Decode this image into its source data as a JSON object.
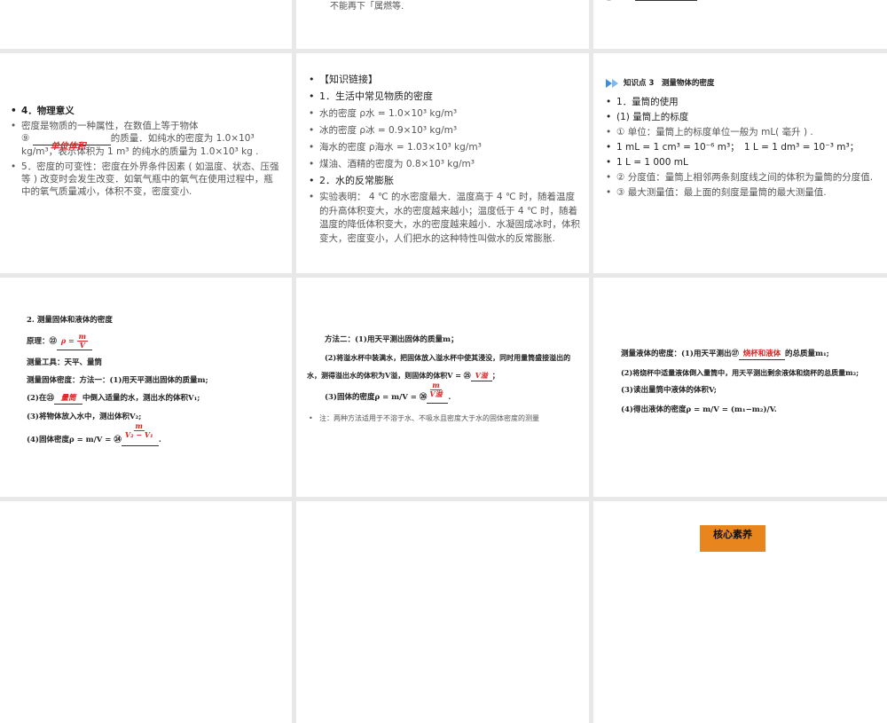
{
  "row1": {
    "mid_text": "不能再下「属燃等.",
    "right_label": "⑤"
  },
  "s4": {
    "items": [
      "4．物理意义",
      "密度是物质的一种属性，在数值上等于物体",
      "的质量．如纯水的密度为 1.0×10³",
      "kg/m³，表示体积为 1 m³ 的纯水的质量为 1.0×10³ kg .",
      "5．密度的可变性：密度在外界条件因素 ( 如温度、状态、压强等 ) 改变时会发生改变．如氧气瓶中的氧气在使用过程中，瓶中的氧气质量减小，体积不变，密度变小."
    ],
    "num": "⑨",
    "answer": "单位体积"
  },
  "s5": {
    "items": [
      "【知识链接】",
      "1．生活中常见物质的密度",
      "水的密度 ρ水 = 1.0×10³ kg/m³",
      "冰的密度 ρ冰 = 0.9×10³ kg/m³",
      "海水的密度 ρ海水 = 1.03×10³ kg/m³",
      "煤油、酒精的密度为 0.8×10³ kg/m³",
      "2．水的反常膨胀",
      "实验表明： 4 ℃ 的水密度最大．温度高于 4 ℃ 时，随着温度的升高体积变大，水的密度越来越小；温度低于 4 ℃ 时，随着温度的降低体积变大，水的密度越来越小．水凝固成冰时，体积变大，密度变小，人们把水的这种特性叫做水的反常膨胀."
    ]
  },
  "s6": {
    "header": "知识点 3　测量物体的密度",
    "items": [
      "1．量筒的使用",
      "(1) 量筒上的标度",
      "① 单位：量筒上的标度单位一般为 mL( 毫升 ) .",
      "1 mL = 1 cm³ = 10⁻⁶ m³；　1 L = 1 dm³ = 10⁻³ m³；",
      "1 L = 1 000 mL",
      "② 分度值：量筒上相邻两条刻度线之间的体积为量筒的分度值.",
      "③ 最大测量值：最上面的刻度是量筒的最大测量值."
    ]
  },
  "s7": {
    "title": "2. 测量固体和液体的密度",
    "principle": "原理：㉒",
    "p_ans_num": "m",
    "p_ans_den": "V",
    "p_ans_pre": "ρ =",
    "tools": "测量工具：天平、量筒",
    "method1": "测量固体密度：方法一：(1)用天平测出固体的质量m;",
    "step2a": "(2)在㉓",
    "step2ans": "量筒",
    "step2b": "中倒入适量的水，测出水的体积V₁;",
    "step3": "(3)将物体放入水中，测出体积V₂;",
    "step4": "(4)固体密度ρ = m/V = ㉔",
    "step4num": "m",
    "step4den": "V₂ − V₁"
  },
  "s8": {
    "l1": "方法二：(1)用天平测出固体的质量m；",
    "l2": "(2)将溢水杯中装满水，把固体放入溢水杯中使其浸没，同时用量筒盛接溢出的",
    "l3": "水，测得溢出水的体积为V溢，则固体的体积V = ㉕",
    "ans25": "V溢",
    "l4": "(3)固体的密度ρ = m/V = ㉖",
    "ans26num": "m",
    "ans26den": "V溢",
    "note": "注：两种方法适用于不溶于水、不吸水且密度大于水的固体密度的测量"
  },
  "s9": {
    "l1a": "测量液体的密度：(1)用天平测出㉗",
    "ans": "烧杯和液体",
    "l1b": "的总质量m₁;",
    "l2": "(2)将烧杯中适量液体倒入量筒中，用天平测出剩余液体和烧杯的总质量m₂;",
    "l3": "(3)读出量筒中液体的体积V;",
    "l4": "(4)得出液体的密度ρ = m/V = (m₁−m₂)/V."
  },
  "s12": {
    "badge": "核心素养"
  }
}
